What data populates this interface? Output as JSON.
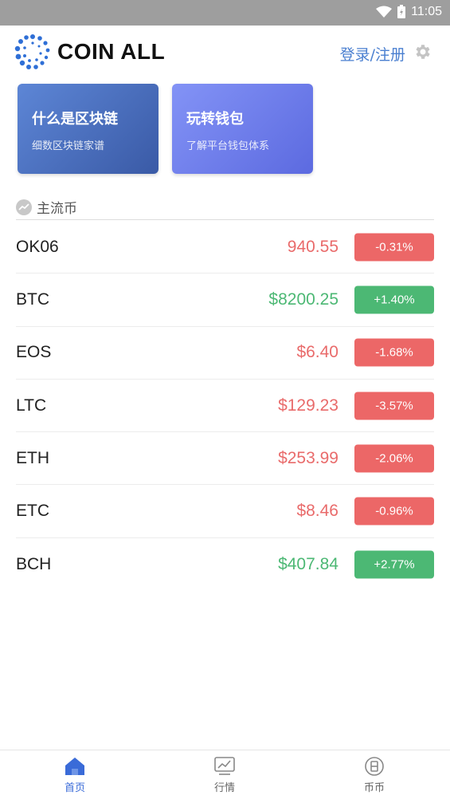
{
  "status_bar": {
    "time": "11:05",
    "icons": [
      "wifi-icon",
      "battery-icon"
    ]
  },
  "header": {
    "logo_text": "COIN ALL",
    "login_label": "登录/注册",
    "settings_icon": "gear-icon"
  },
  "promo_cards": [
    {
      "title": "什么是区块链",
      "subtitle": "细数区块链家谱"
    },
    {
      "title": "玩转钱包",
      "subtitle": "了解平台钱包体系"
    }
  ],
  "section": {
    "label": "主流币",
    "icon": "trend-icon"
  },
  "coins": [
    {
      "name": "OK06",
      "price": "940.55",
      "change": "-0.31%",
      "trend": "down"
    },
    {
      "name": "BTC",
      "price": "$8200.25",
      "change": "+1.40%",
      "trend": "up"
    },
    {
      "name": "EOS",
      "price": "$6.40",
      "change": "-1.68%",
      "trend": "down"
    },
    {
      "name": "LTC",
      "price": "$129.23",
      "change": "-3.57%",
      "trend": "down"
    },
    {
      "name": "ETH",
      "price": "$253.99",
      "change": "-2.06%",
      "trend": "down"
    },
    {
      "name": "ETC",
      "price": "$8.46",
      "change": "-0.96%",
      "trend": "down"
    },
    {
      "name": "BCH",
      "price": "$407.84",
      "change": "+2.77%",
      "trend": "up"
    }
  ],
  "colors": {
    "up": "#4cb874",
    "down": "#ec6767",
    "accent": "#3a6bd8"
  },
  "tabbar": {
    "tabs": [
      {
        "label": "首页",
        "icon": "home-icon",
        "active": true
      },
      {
        "label": "行情",
        "icon": "chart-icon",
        "active": false
      },
      {
        "label": "币币",
        "icon": "coin-icon",
        "active": false
      }
    ]
  }
}
